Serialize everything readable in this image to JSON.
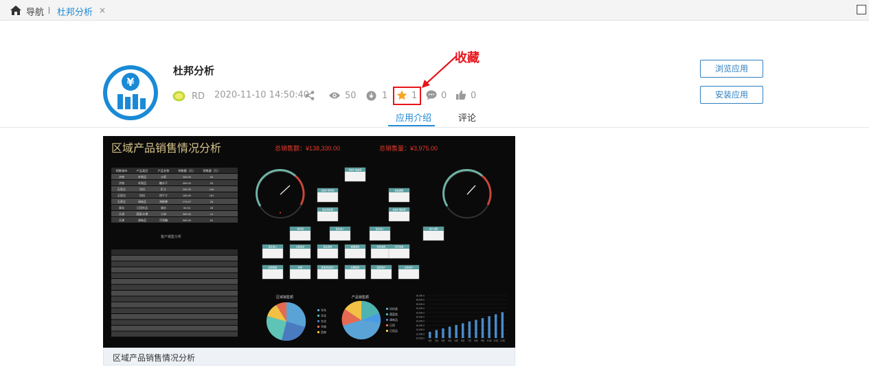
{
  "topbar": {
    "nav_label": "导航",
    "tab_label": "杜邦分析",
    "tab_close": "×"
  },
  "app": {
    "title": "杜邦分析",
    "author": "RD",
    "datetime": "2020-11-10 14:50:40",
    "views": "50",
    "downloads": "1",
    "favorites": "1",
    "comments": "0",
    "likes": "0"
  },
  "annotation": {
    "label": "收藏",
    "color": "#e8141b"
  },
  "buttons": {
    "browse": "浏览应用",
    "install": "安装应用"
  },
  "tabs": {
    "intro": "应用介绍",
    "comments": "评论"
  },
  "preview": {
    "title": "区域产品销售情况分析",
    "total_sales_label": "总销售额：¥138,330.00",
    "total_qty_label": "总销售量：¥3,975.00",
    "caption": "区域产品销售情况分析",
    "table1_headers": [
      "销售城市",
      "产品类目",
      "产品名称",
      "销售额（万）",
      "销售量（万）"
    ],
    "table1_rows": [
      [
        "济南",
        "补税品",
        "沙浆",
        "265.00",
        "53"
      ],
      [
        "济南",
        "补税品",
        "糖水干",
        "465.00",
        "63"
      ],
      [
        "石家庄",
        "饮料",
        "矿汁",
        "265.00",
        "106"
      ],
      [
        "石家庄",
        "饮料",
        "饼干丁",
        "189.00",
        "181"
      ],
      [
        "石家庄",
        "调味品",
        "海鲜酱",
        "176.67",
        "28"
      ],
      [
        "青岛",
        "日用杂品",
        "湖水",
        "50.00",
        "28"
      ],
      [
        "天津",
        "蔬菜/水果",
        "小米",
        "365.00",
        "41"
      ],
      [
        "天津",
        "调味品",
        "月亮糖",
        "365.00",
        "81"
      ]
    ],
    "mid_label": "客户销售分析",
    "pie1_label": "区域销售额",
    "pie2_label": "产品销售额",
    "pie1_legend": [
      "华东",
      "华北",
      "东北",
      "华南",
      "西南"
    ],
    "pie2_legend": [
      "饮料类",
      "蔬菜类",
      "调味品",
      "日用",
      "日用品"
    ],
    "funnel_nodes": [
      "净资产收益率",
      "总资产净利率",
      "权益乘数",
      "营业净利率",
      "总资产周转率",
      "净利润",
      "营业收入",
      "营业收入",
      "资产总额",
      "营业收入",
      "主营成本",
      "营业费用",
      "管理费用",
      "财务费用",
      "货币资金",
      "应收账款",
      "存货",
      "其他流动资产",
      "长期投资",
      "固定资产",
      "无形资产"
    ],
    "bar_months": [
      "1月",
      "2月",
      "3月",
      "4月",
      "5月",
      "6月",
      "7月",
      "8月",
      "9月",
      "10月",
      "11月",
      "12月"
    ],
    "bar_values": [
      11000,
      11800,
      12600,
      13400,
      14200,
      15000,
      15800,
      16600,
      17400,
      18300,
      19200,
      20200
    ],
    "bar_ticks": [
      "30,000.0",
      "28,000.0",
      "26,000.0",
      "24,000.0",
      "22,000.0",
      "20,000.0",
      "18,000.0",
      "16,000.0",
      "14,000.0",
      "12,000.0",
      "10,000.0"
    ]
  },
  "colors": {
    "accent": "#1e88d4",
    "button_border": "#2f7fbf"
  }
}
